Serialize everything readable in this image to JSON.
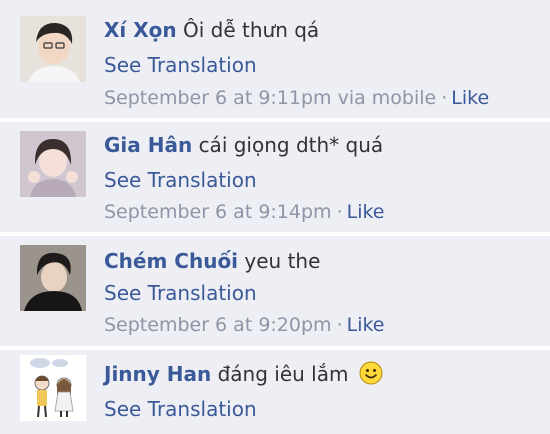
{
  "comments": [
    {
      "author": "Xí Xọn",
      "text": "Ôi dễ thưn qá",
      "see_translation": "See Translation",
      "time": "September 6 at 9:11pm via mobile",
      "like": "Like",
      "avatar_icon": "user-photo-icon"
    },
    {
      "author": "Gia Hân",
      "text": "cái giọng dth* quá",
      "see_translation": "See Translation",
      "time": "September 6 at 9:14pm",
      "like": "Like",
      "avatar_icon": "user-photo-icon"
    },
    {
      "author": "Chém Chuối",
      "text": "yeu the",
      "see_translation": "See Translation",
      "time": "September 6 at 9:20pm",
      "like": "Like",
      "avatar_icon": "user-photo-icon"
    },
    {
      "author": "Jinny Han",
      "text": "đáng iêu lắm",
      "see_translation": "See Translation",
      "time": "",
      "like": "",
      "avatar_icon": "cartoon-couple-icon",
      "emoji": "smiley-face-icon"
    }
  ],
  "colors": {
    "background": "#edeff4",
    "separator": "#ffffff",
    "author_link": "#3b5998",
    "meta_text": "#8e95a6",
    "body_text": "#333333"
  }
}
